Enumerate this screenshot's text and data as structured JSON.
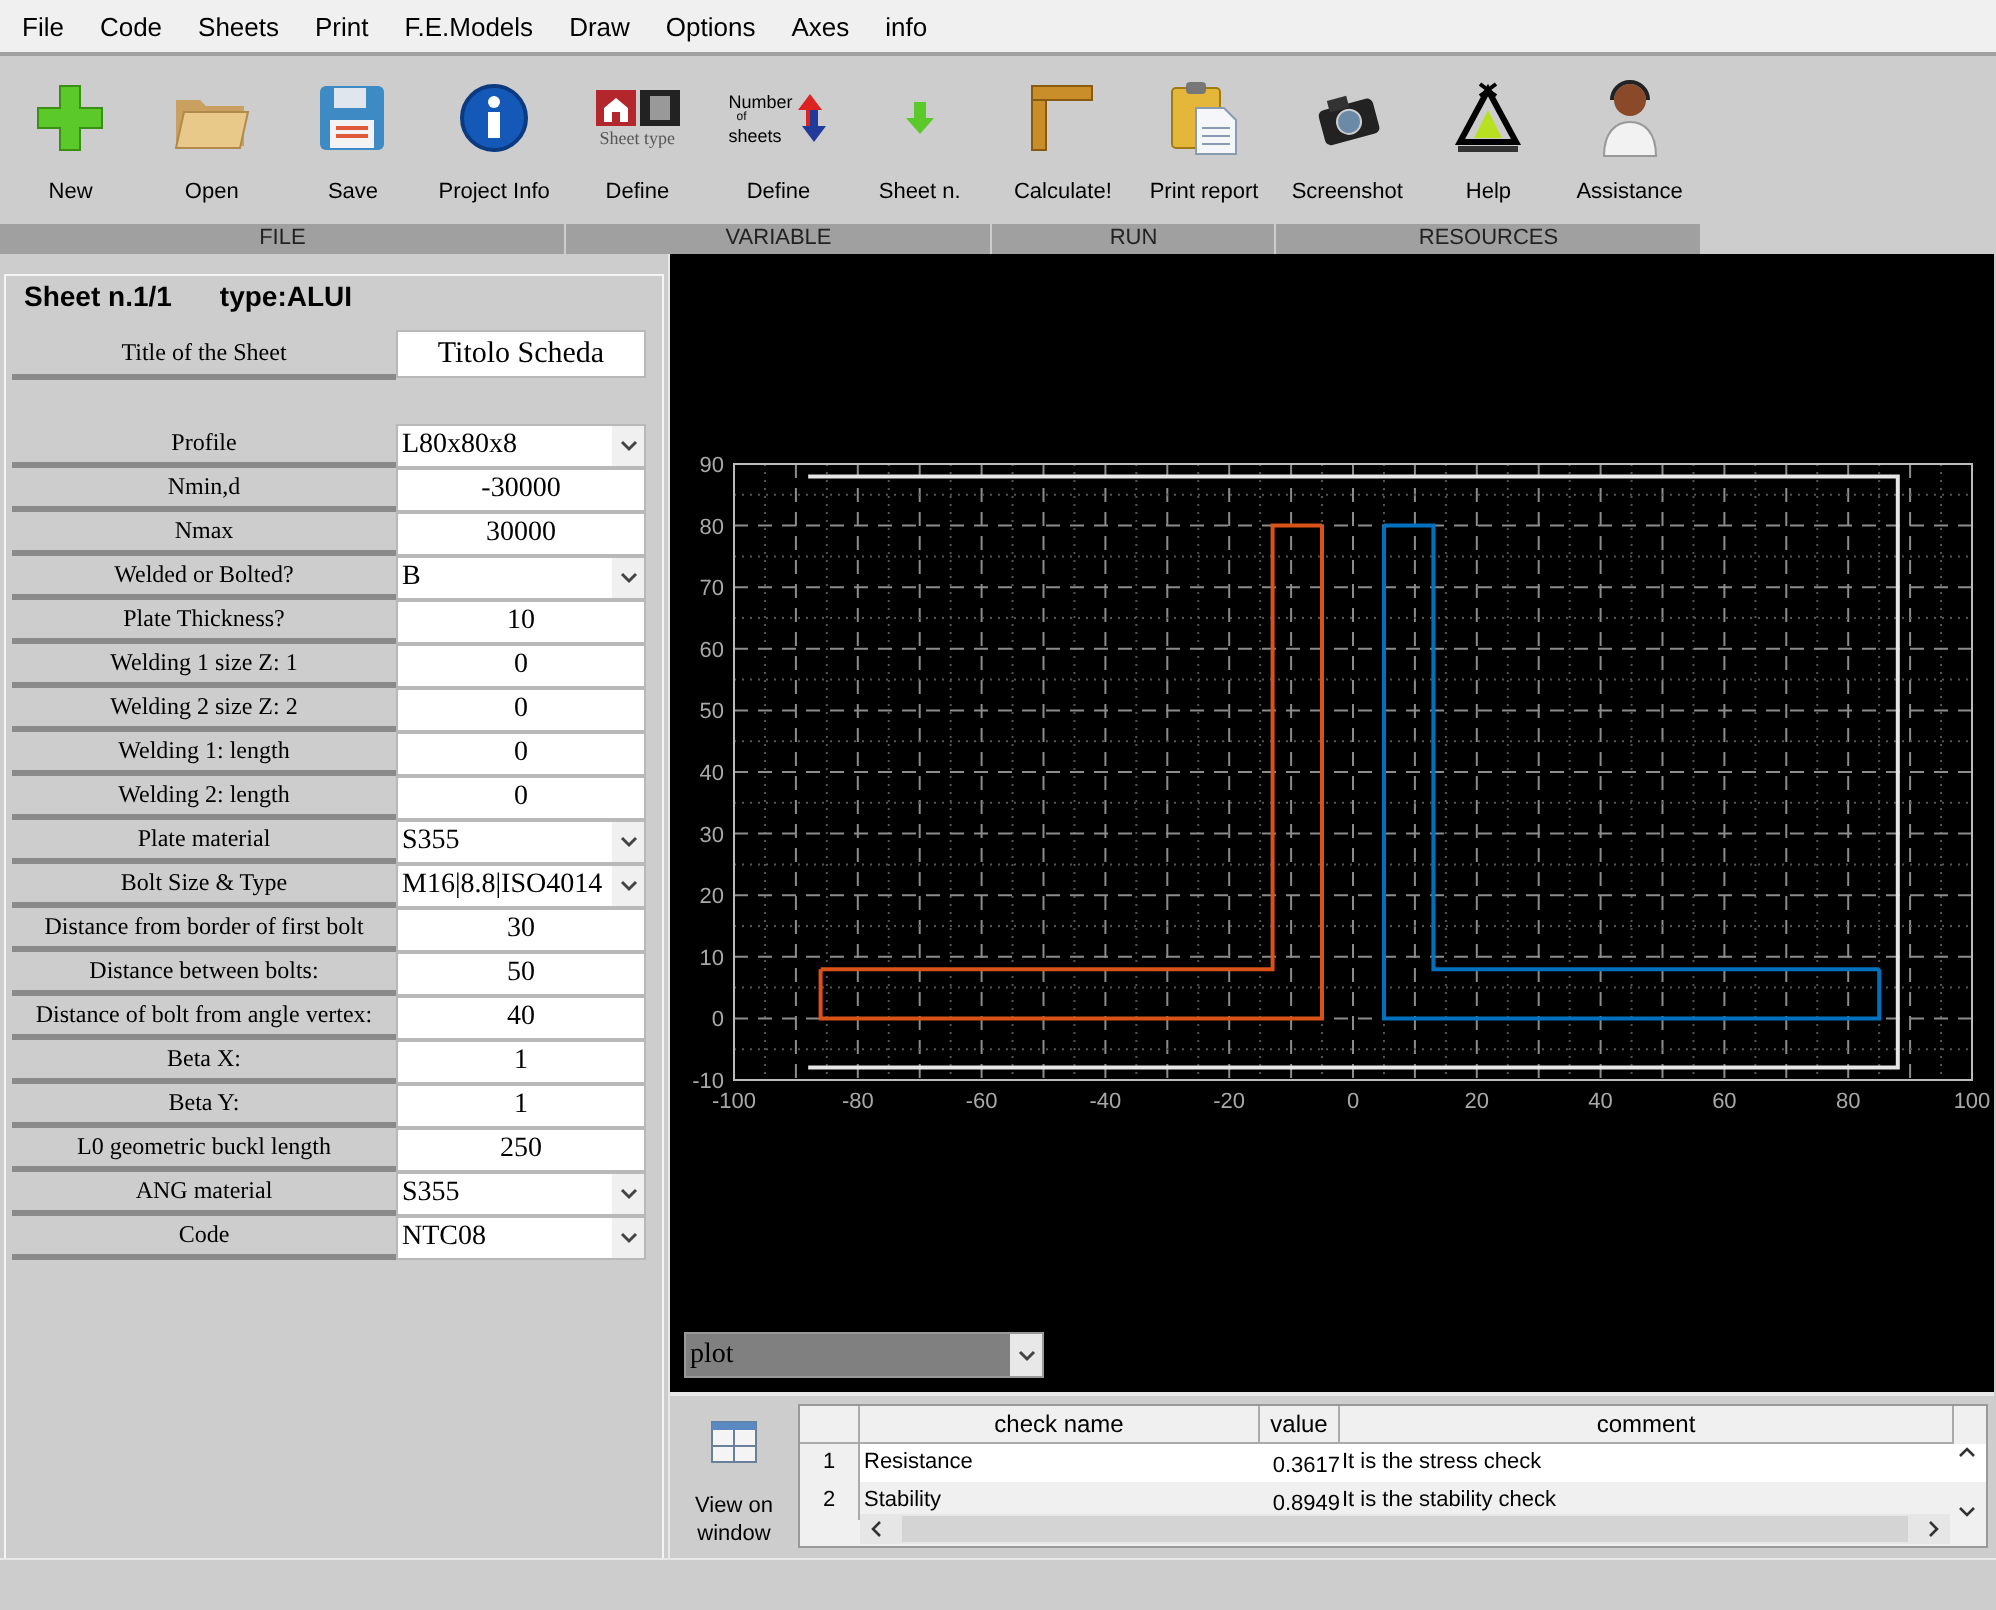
{
  "menu": [
    "File",
    "Code",
    "Sheets",
    "Print",
    "F.E.Models",
    "Draw",
    "Options",
    "Axes",
    "info"
  ],
  "toolbar": {
    "groups": [
      {
        "label": "FILE",
        "items": [
          {
            "label": "New",
            "kind": "plus"
          },
          {
            "label": "Open",
            "kind": "folder"
          },
          {
            "label": "Save",
            "kind": "floppy"
          },
          {
            "label": "Project Info",
            "kind": "info"
          }
        ]
      },
      {
        "label": "VARIABLE",
        "items": [
          {
            "label": "Define",
            "kind": "sheet-type",
            "icon_text": [
              "Sheet type"
            ]
          },
          {
            "label": "Define",
            "kind": "sheet-count",
            "icon_text": [
              "Number",
              "of",
              "sheets"
            ]
          },
          {
            "label": "Sheet n.",
            "kind": "down-arrow"
          }
        ]
      },
      {
        "label": "RUN",
        "items": [
          {
            "label": "Calculate!",
            "kind": "square"
          },
          {
            "label": "Print report",
            "kind": "clipboard"
          }
        ]
      },
      {
        "label": "RESOURCES",
        "items": [
          {
            "label": "Screenshot",
            "kind": "camera"
          },
          {
            "label": "Help",
            "kind": "tent"
          },
          {
            "label": "Assistance",
            "kind": "person"
          }
        ]
      }
    ]
  },
  "sheet": {
    "legend": "Sheet n.1/1",
    "type": "type:ALUI",
    "title": {
      "label": "Title of the Sheet",
      "value": "Titolo Scheda"
    },
    "fields": [
      {
        "label": "Profile",
        "kind": "select",
        "value": "L80x80x8"
      },
      {
        "label": "Nmin,d",
        "kind": "input",
        "value": "-30000"
      },
      {
        "label": "Nmax",
        "kind": "input",
        "value": "30000"
      },
      {
        "label": "Welded or Bolted?",
        "kind": "select",
        "value": "B"
      },
      {
        "label": "Plate Thickness?",
        "kind": "input",
        "value": "10"
      },
      {
        "label": "Welding 1 size Z: 1",
        "kind": "input",
        "value": "0"
      },
      {
        "label": "Welding 2 size Z: 2",
        "kind": "input",
        "value": "0"
      },
      {
        "label": "Welding 1: length",
        "kind": "input",
        "value": "0"
      },
      {
        "label": "Welding 2: length",
        "kind": "input",
        "value": "0"
      },
      {
        "label": "Plate material",
        "kind": "select",
        "value": "S355"
      },
      {
        "label": "Bolt Size & Type",
        "kind": "select",
        "value": "M16|8.8|ISO4014"
      },
      {
        "label": "Distance from border of first bolt",
        "kind": "input",
        "value": "30"
      },
      {
        "label": "Distance between bolts:",
        "kind": "input",
        "value": "50"
      },
      {
        "label": "Distance of bolt from angle vertex:",
        "kind": "input",
        "value": "40"
      },
      {
        "label": "Beta X:",
        "kind": "input",
        "value": "1"
      },
      {
        "label": "Beta Y:",
        "kind": "input",
        "value": "1"
      },
      {
        "label": "L0 geometric buckl length",
        "kind": "input",
        "value": "250"
      },
      {
        "label": "ANG material",
        "kind": "select",
        "value": "S355"
      },
      {
        "label": "Code",
        "kind": "select",
        "value": "NTC08"
      }
    ]
  },
  "plot": {
    "selector": {
      "value": "plot"
    },
    "chart_data": {
      "type": "line",
      "grid": true,
      "xlim": [
        -100,
        100
      ],
      "ylim": [
        -10,
        90
      ],
      "xticks": [
        -100,
        -80,
        -60,
        -40,
        -20,
        0,
        20,
        40,
        60,
        80,
        100
      ],
      "yticks": [
        -10,
        0,
        10,
        20,
        30,
        40,
        50,
        60,
        70,
        80,
        90
      ],
      "series": [
        {
          "color": "#d95319",
          "x": [
            -86,
            -86,
            -5,
            -5
          ],
          "values": [
            8,
            0,
            0,
            80
          ]
        },
        {
          "color": "#d95319",
          "x": [
            -86,
            -13,
            -13,
            -5
          ],
          "values": [
            8,
            8,
            80,
            80
          ]
        },
        {
          "color": "#0072bd",
          "x": [
            5,
            5,
            85,
            85
          ],
          "values": [
            80,
            0,
            0,
            8
          ]
        },
        {
          "color": "#0072bd",
          "x": [
            5,
            13,
            13,
            85
          ],
          "values": [
            80,
            80,
            8,
            8
          ]
        },
        {
          "color": "#e6e6e6",
          "x": [
            -88,
            88,
            88,
            -88
          ],
          "values": [
            88,
            88,
            -8,
            -8
          ]
        }
      ]
    }
  },
  "results": {
    "view_button": "View on window",
    "columns": [
      "check name",
      "value",
      "comment"
    ],
    "rows": [
      {
        "number": "1",
        "check_name": "Resistance",
        "value": "0.3617",
        "comment": "It is the stress check"
      },
      {
        "number": "2",
        "check_name": "Stability",
        "value": "0.8949",
        "comment": "It is the stability check"
      }
    ]
  }
}
